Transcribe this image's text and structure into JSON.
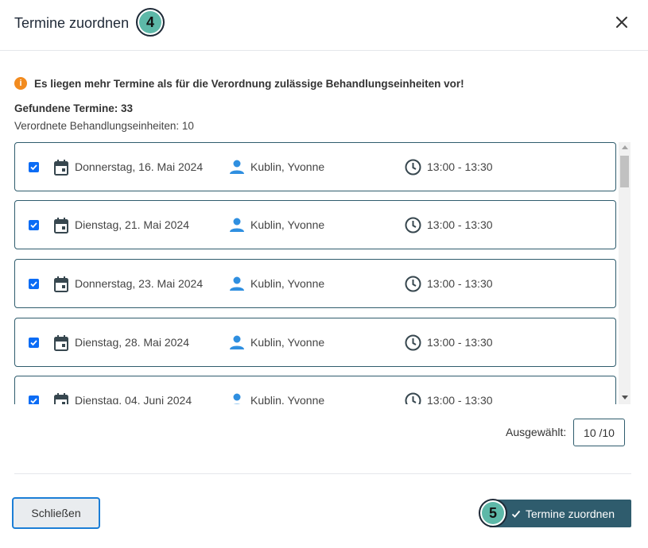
{
  "dialog": {
    "title": "Termine zuordnen",
    "step_badge_title": "4",
    "close_icon": "close-icon"
  },
  "warning": {
    "icon": "info-icon",
    "icon_glyph": "i",
    "text": "Es liegen mehr Termine als für die Verordnung zulässige Behandlungseinheiten vor!"
  },
  "summary": {
    "found": "Gefundene Termine: 33",
    "prescribed": "Verordnete Behandlungseinheiten: 10"
  },
  "appointments": [
    {
      "checked": true,
      "date": "Donnerstag, 16. Mai 2024",
      "therapist": "Kublin, Yvonne",
      "time": "13:00 - 13:30"
    },
    {
      "checked": true,
      "date": "Dienstag, 21. Mai 2024",
      "therapist": "Kublin, Yvonne",
      "time": "13:00 - 13:30"
    },
    {
      "checked": true,
      "date": "Donnerstag, 23. Mai 2024",
      "therapist": "Kublin, Yvonne",
      "time": "13:00 - 13:30"
    },
    {
      "checked": true,
      "date": "Dienstag, 28. Mai 2024",
      "therapist": "Kublin, Yvonne",
      "time": "13:00 - 13:30"
    },
    {
      "checked": true,
      "date": "Dienstag, 04. Juni 2024",
      "therapist": "Kublin, Yvonne",
      "time": "13:00 - 13:30"
    }
  ],
  "selection": {
    "label": "Ausgewählt:",
    "value": "10 /10"
  },
  "footer": {
    "close_label": "Schließen",
    "assign_label": "Termine zuordnen",
    "step_badge_assign": "5"
  },
  "colors": {
    "accent": "#2f5c6d",
    "checkbox": "#0b6cf5",
    "warning": "#f28b1f",
    "badge": "#5db8a8"
  }
}
